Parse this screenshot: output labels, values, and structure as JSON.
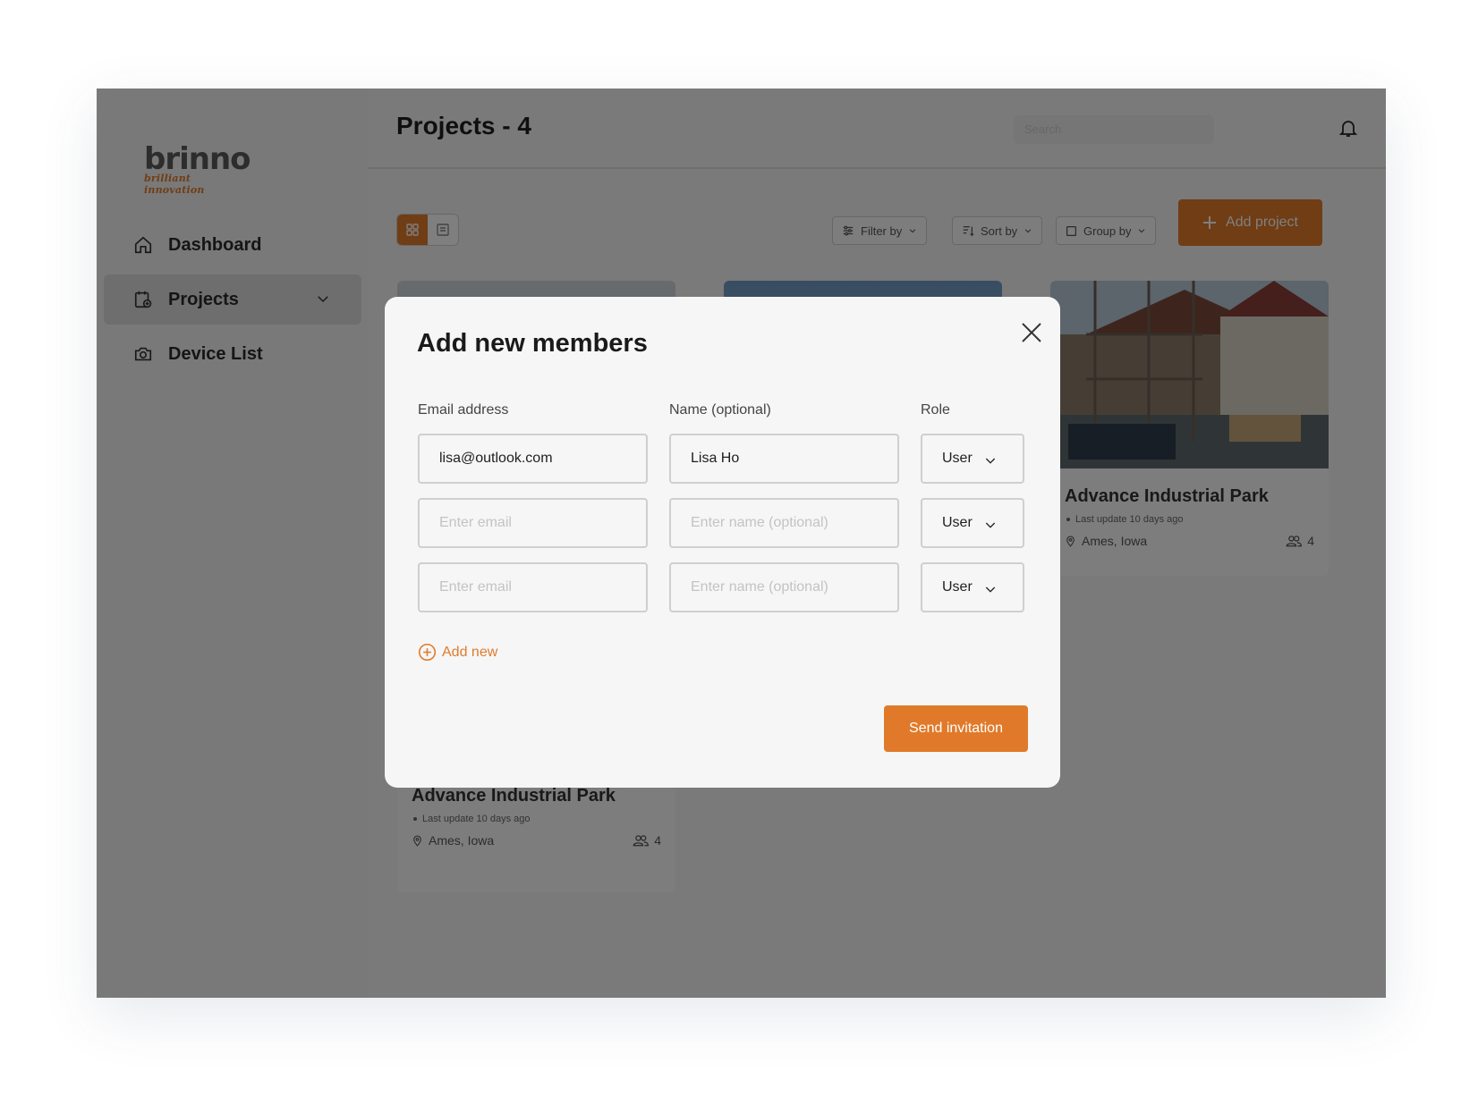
{
  "app": {
    "logo_word": "brinno",
    "logo_tagline": "brilliant innovation"
  },
  "sidebar": {
    "items": [
      {
        "label": "Dashboard",
        "icon": "home-icon"
      },
      {
        "label": "Projects",
        "icon": "projects-icon",
        "active": true
      },
      {
        "label": "Device List",
        "icon": "camera-icon"
      }
    ]
  },
  "header": {
    "title": "Projects - 4",
    "search_placeholder": "Search"
  },
  "toolbar": {
    "filter_label": "Filter by",
    "sort_label": "Sort by",
    "group_label": "Group by",
    "add_project_label": "Add project"
  },
  "cards": [
    {
      "title": "Advance Industrial Park",
      "update": "Last update 10 days ago",
      "location": "Ames, Iowa",
      "members": "4"
    },
    {
      "title": "Advance Industrial Park",
      "update": "Last update 10 days ago",
      "location": "Ames, Iowa",
      "members": "4"
    }
  ],
  "modal": {
    "title": "Add new members",
    "email_label": "Email address",
    "name_label": "Name (optional)",
    "role_label": "Role",
    "rows": [
      {
        "email": "lisa@outlook.com",
        "name": "Lisa Ho",
        "role": "User"
      },
      {
        "email_placeholder": "Enter email",
        "name_placeholder": "Enter name (optional)",
        "role": "User"
      },
      {
        "email_placeholder": "Enter email",
        "name_placeholder": "Enter name (optional)",
        "role": "User"
      }
    ],
    "add_new_label": "Add new",
    "send_label": "Send invitation"
  },
  "colors": {
    "accent": "#e07a2a",
    "overlay": "rgba(0,0,0,0.5)"
  }
}
